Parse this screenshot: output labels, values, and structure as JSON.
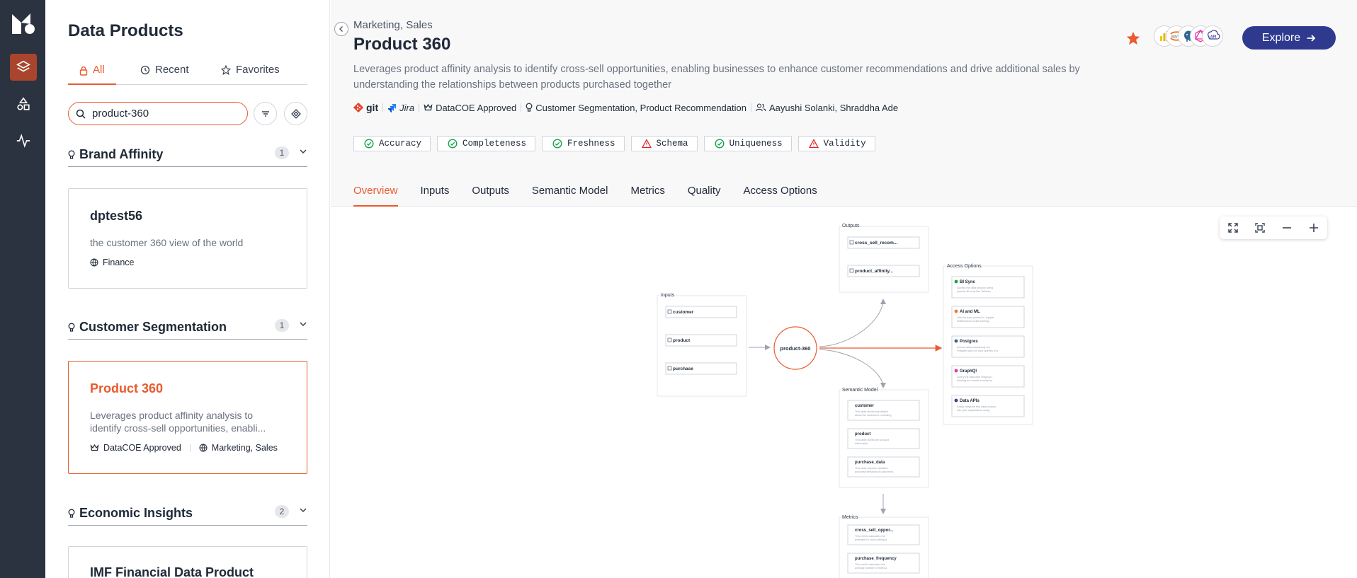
{
  "sidebar": {
    "title": "Data Products",
    "tabs": [
      {
        "label": "All",
        "icon": "lock-icon",
        "active": true
      },
      {
        "label": "Recent",
        "icon": "history-icon"
      },
      {
        "label": "Favorites",
        "icon": "star-outline-icon"
      }
    ],
    "search_value": "product-360",
    "search_placeholder": "Search",
    "groups": [
      {
        "name": "Brand Affinity",
        "count": "1",
        "cards": [
          {
            "title": "dptest56",
            "desc": "the customer 360 view of the world",
            "domain": "Finance"
          }
        ]
      },
      {
        "name": "Customer Segmentation",
        "count": "1",
        "cards": [
          {
            "title": "Product 360",
            "desc": "Leverages product affinity analysis to identify cross-sell opportunities, enabli...",
            "badge": "DataCOE Approved",
            "domain": "Marketing, Sales",
            "selected": true
          }
        ]
      },
      {
        "name": "Economic Insights",
        "count": "2",
        "cards": [
          {
            "title": "IMF Financial Data Product"
          }
        ]
      }
    ]
  },
  "product": {
    "domains": "Marketing, Sales",
    "title": "Product 360",
    "description": "Leverages product affinity analysis to identify cross-sell opportunities, enabling businesses to enhance customer recommendations and drive additional sales by understanding the relationships between products purchased together",
    "git_label": "git",
    "jira_label": "Jira",
    "badge": "DataCOE Approved",
    "use_cases": "Customer Segmentation, Product Recommendation",
    "owners": "Aayushi Solanki, Shraddha Ade",
    "quality_checks": [
      {
        "label": "Accuracy",
        "status": "pass"
      },
      {
        "label": "Completeness",
        "status": "pass"
      },
      {
        "label": "Freshness",
        "status": "pass"
      },
      {
        "label": "Schema",
        "status": "warn"
      },
      {
        "label": "Uniqueness",
        "status": "pass"
      },
      {
        "label": "Validity",
        "status": "warn"
      }
    ],
    "explore_label": "Explore",
    "access_avatars": [
      "bi-sync-icon",
      "jupyter-icon",
      "postgres-icon",
      "graphql-icon",
      "api-icon"
    ]
  },
  "tabs": [
    "Overview",
    "Inputs",
    "Outputs",
    "Semantic Model",
    "Metrics",
    "Quality",
    "Access Options"
  ],
  "active_tab": "Overview",
  "colors": {
    "accent": "#ea5a2e",
    "rail": "#2b3240",
    "explore": "#2f3a8f",
    "pass": "#16a34a",
    "warn": "#dc2626"
  },
  "graph": {
    "center": "product-360",
    "inputs": {
      "title": "Inputs",
      "items": [
        "customer",
        "product",
        "purchase"
      ]
    },
    "outputs": {
      "title": "Outputs",
      "items": [
        "cross_sell_recom...",
        "product_affinity..."
      ]
    },
    "semantic": {
      "title": "Semantic Model",
      "items": [
        {
          "name": "customer",
          "desc": "This table stores key details about the customers, including their personal info..."
        },
        {
          "name": "product",
          "desc": "This table stores the product information"
        },
        {
          "name": "purchase_data",
          "desc": "This table captures detailed purchase behavior of customers, including their tra..."
        }
      ]
    },
    "metrics": {
      "title": "Metrics",
      "items": [
        {
          "name": "cross_sell_oppor...",
          "desc": "This metric calculates the potential for cross-selling a secondary product to cus..."
        },
        {
          "name": "purchase_frequency",
          "desc": "This metric calculates the average number of times a product is purchased by cus..."
        }
      ]
    },
    "access": {
      "title": "Access Options",
      "items": [
        {
          "name": "BI Sync",
          "desc": "Access the data product using popular BI tools like Tableau, PowerBI, Excel, and others"
        },
        {
          "name": "AI and ML",
          "desc": "Use the data product in Jupyter Notebooks to build training, infer, ML and uses"
        },
        {
          "name": "Postgres",
          "desc": "Access data seamlessly via Postgres and run your queries in a familiar environment"
        },
        {
          "name": "GraphQl",
          "desc": "Query the data with GraphQL, tailoring the results exactly as needed"
        },
        {
          "name": "Data APIs",
          "desc": "Easily integrate this data product into your applications using RESTful and detailed APIs"
        }
      ]
    }
  }
}
